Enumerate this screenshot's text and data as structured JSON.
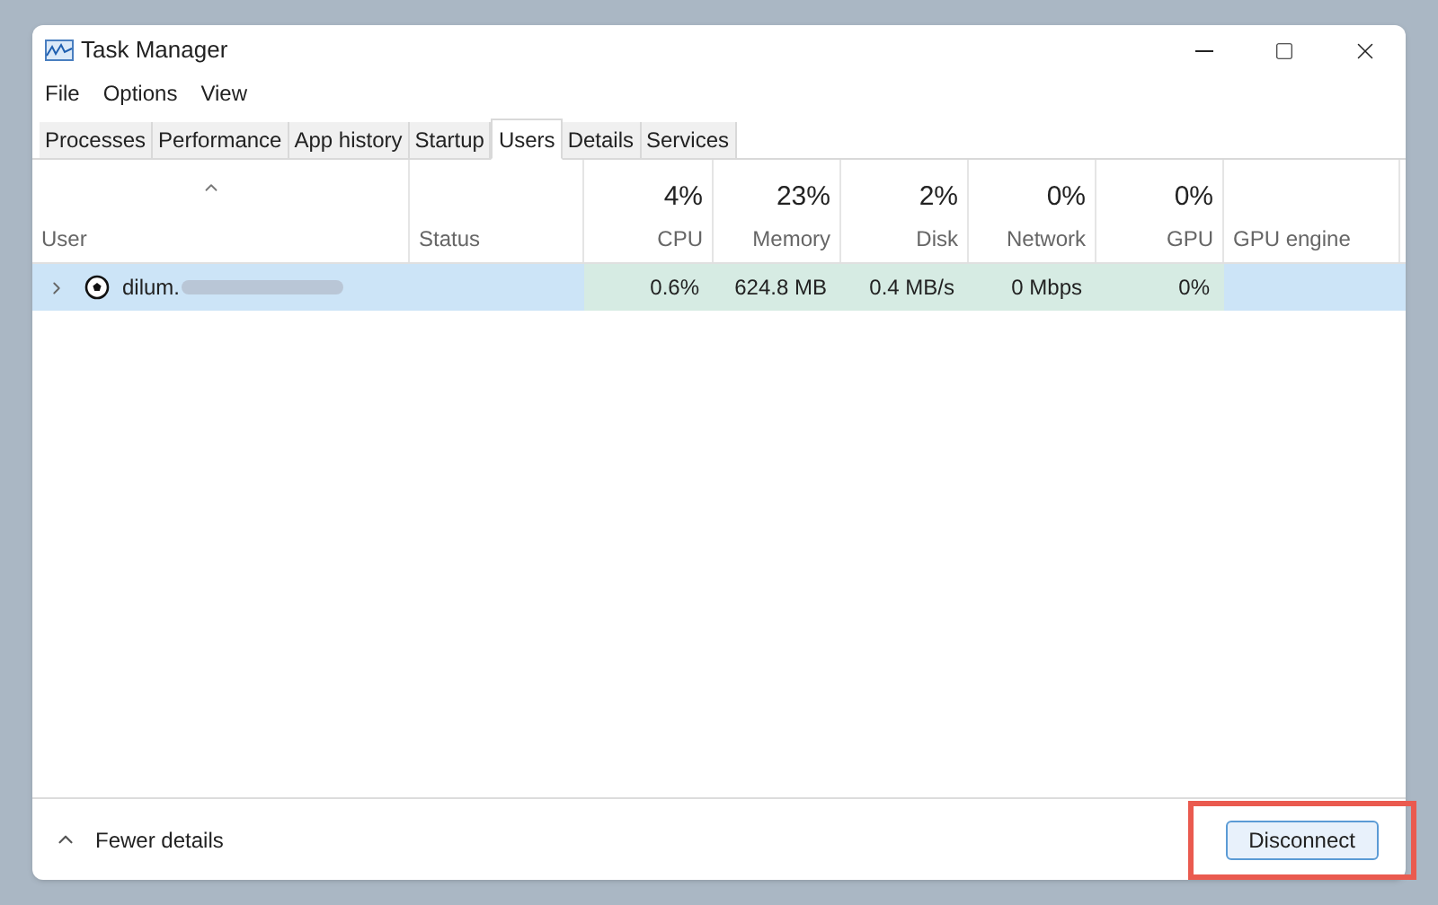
{
  "window": {
    "title": "Task Manager"
  },
  "menu": [
    "File",
    "Options",
    "View"
  ],
  "tabs": [
    {
      "label": "Processes",
      "selected": false
    },
    {
      "label": "Performance",
      "selected": false
    },
    {
      "label": "App history",
      "selected": false
    },
    {
      "label": "Startup",
      "selected": false
    },
    {
      "label": "Users",
      "selected": true
    },
    {
      "label": "Details",
      "selected": false
    },
    {
      "label": "Services",
      "selected": false
    }
  ],
  "table": {
    "columns": [
      {
        "label": "User",
        "kind": "text"
      },
      {
        "label": "Status",
        "kind": "text"
      },
      {
        "label": "CPU",
        "usage": "4%",
        "kind": "metric"
      },
      {
        "label": "Memory",
        "usage": "23%",
        "kind": "metric"
      },
      {
        "label": "Disk",
        "usage": "2%",
        "kind": "metric"
      },
      {
        "label": "Network",
        "usage": "0%",
        "kind": "metric"
      },
      {
        "label": "GPU",
        "usage": "0%",
        "kind": "metric"
      },
      {
        "label": "GPU engine",
        "kind": "text"
      }
    ],
    "rows": [
      {
        "expanded": false,
        "selected": true,
        "cells": [
          "dilum.",
          "",
          "0.6%",
          "624.8 MB",
          "0.4 MB/s",
          "0 Mbps",
          "0%",
          ""
        ]
      }
    ]
  },
  "footer": {
    "toggle": "Fewer details",
    "button": "Disconnect",
    "highlighted": true
  }
}
